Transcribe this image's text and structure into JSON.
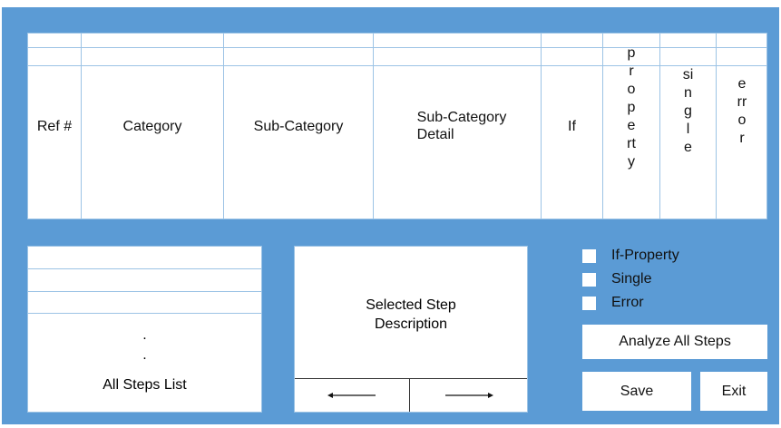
{
  "table": {
    "headers": [
      "Ref #",
      "Category",
      "Sub-Category",
      "Sub-Category\nDetail",
      "If",
      "property",
      "single",
      "error"
    ]
  },
  "steps_list": {
    "dots": [
      ".",
      "."
    ],
    "label": "All Steps List"
  },
  "description": {
    "text": "Selected Step\nDescription",
    "prev_icon": "left-arrow-icon",
    "next_icon": "right-arrow-icon"
  },
  "checkboxes": [
    {
      "label": "If-Property",
      "checked": false
    },
    {
      "label": "Single",
      "checked": false
    },
    {
      "label": "Error",
      "checked": false
    }
  ],
  "buttons": {
    "analyze": "Analyze All Steps",
    "save": "Save",
    "exit": "Exit"
  },
  "colors": {
    "background": "#5b9bd5",
    "panel": "#ffffff",
    "grid_line": "#9cc3e5"
  }
}
